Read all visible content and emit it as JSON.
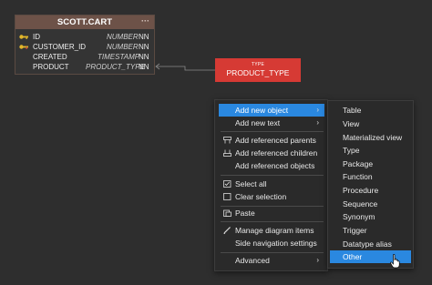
{
  "table": {
    "name": "SCOTT.CART",
    "menu_glyph": "···",
    "columns": [
      {
        "name": "ID",
        "type": "NUMBER",
        "nn": "NN",
        "key": "pk"
      },
      {
        "name": "CUSTOMER_ID",
        "type": "NUMBER",
        "nn": "NN",
        "key": "fk"
      },
      {
        "name": "CREATED",
        "type": "TIMESTAMP",
        "nn": "NN",
        "key": ""
      },
      {
        "name": "PRODUCT",
        "type": "PRODUCT_TYPE",
        "nn": "NN",
        "key": ""
      }
    ]
  },
  "type_object": {
    "caption": "TYPE",
    "name": "PRODUCT_TYPE",
    "color": "#d63a34"
  },
  "context_menu": {
    "items": [
      {
        "label": "Add new object",
        "has_submenu": true,
        "icon": "",
        "active": true
      },
      {
        "label": "Add new text",
        "has_submenu": true,
        "icon": ""
      },
      {
        "label": "Add referenced parents",
        "icon": "referenced-parents-icon"
      },
      {
        "label": "Add referenced children",
        "icon": "referenced-children-icon"
      },
      {
        "label": "Add referenced objects",
        "icon": ""
      },
      {
        "label": "Select all",
        "icon": "checkbox-checked-icon"
      },
      {
        "label": "Clear selection",
        "icon": "checkbox-empty-icon"
      },
      {
        "label": "Paste",
        "icon": "paste-icon"
      },
      {
        "label": "Manage diagram items",
        "icon": "pencil-icon"
      },
      {
        "label": "Side navigation settings",
        "icon": ""
      },
      {
        "label": "Advanced",
        "has_submenu": true,
        "icon": ""
      }
    ],
    "arrow_glyph": "›"
  },
  "submenu": {
    "items": [
      "Table",
      "View",
      "Materialized view",
      "Type",
      "Package",
      "Function",
      "Procedure",
      "Sequence",
      "Synonym",
      "Trigger",
      "Datatype alias",
      "Other"
    ],
    "active_index": 11
  },
  "colors": {
    "accent": "#2a88e0",
    "header": "#6d5248",
    "background": "#2e2e2e"
  }
}
